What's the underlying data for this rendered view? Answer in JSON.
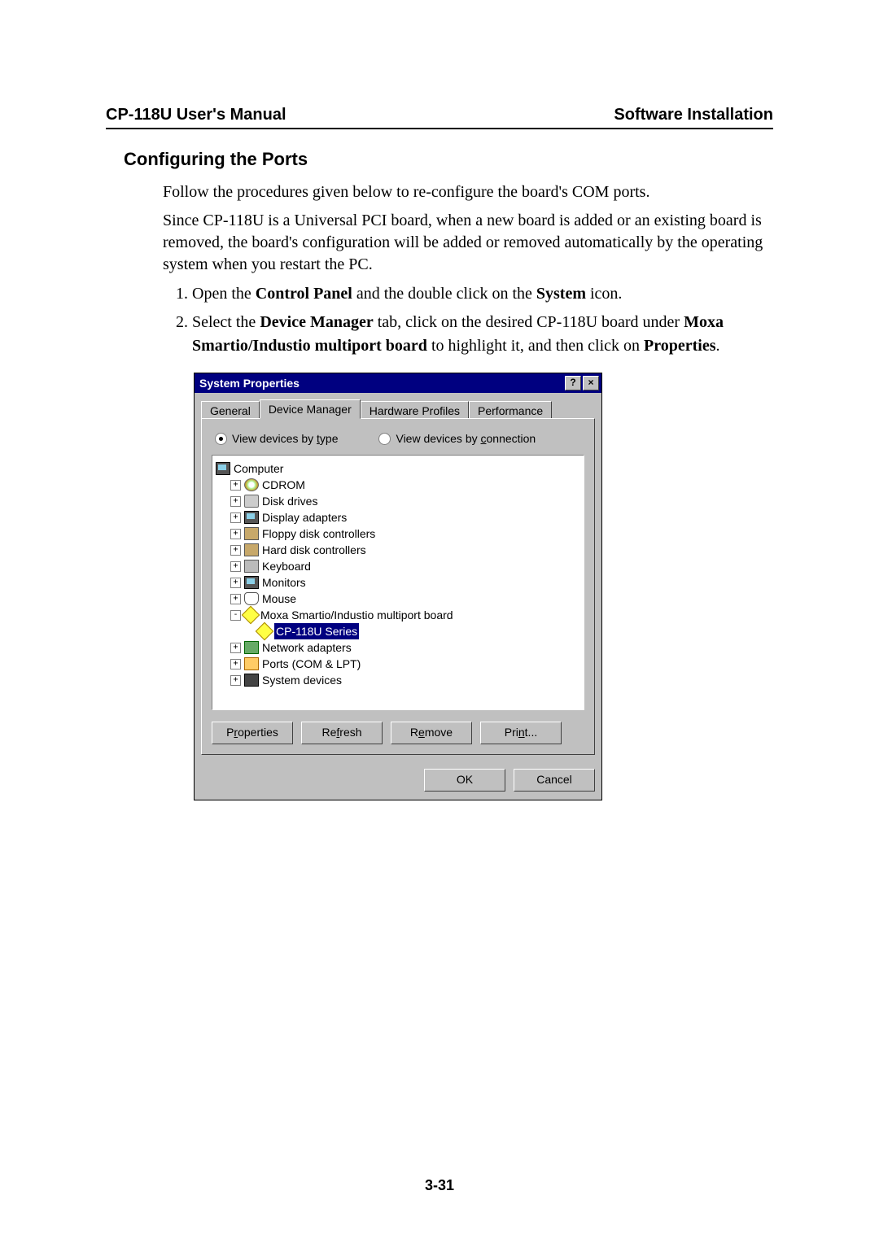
{
  "header": {
    "left": "CP-118U User's Manual",
    "right": "Software Installation"
  },
  "section_heading": "Configuring the Ports",
  "intro1": "Follow the procedures given below to re-configure the board's COM ports.",
  "intro2": "Since CP-118U is a Universal PCI board, when a new board is added or an existing board is removed, the board's configuration will be added or removed automatically by the operating system when you restart the PC.",
  "steps": {
    "s1_a": "Open the ",
    "s1_b": "Control Panel",
    "s1_c": " and the double click on the ",
    "s1_d": "System",
    "s1_e": " icon.",
    "s2_a": "Select the ",
    "s2_b": "Device Manager",
    "s2_c": " tab, click on the desired CP-118U board under ",
    "s2_d": "Moxa Smartio/Industio multiport board",
    "s2_e": " to highlight it, and then click on ",
    "s2_f": "Properties",
    "s2_g": "."
  },
  "dialog": {
    "title": "System Properties",
    "help_btn": "?",
    "close_btn": "×",
    "tabs": {
      "general": "General",
      "device_manager": "Device Manager",
      "hardware_profiles": "Hardware Profiles",
      "performance": "Performance"
    },
    "radios": {
      "by_type_pre": "View devices by ",
      "by_type_u": "t",
      "by_type_post": "ype",
      "by_conn_pre": "View devices by ",
      "by_conn_u": "c",
      "by_conn_post": "onnection"
    },
    "tree": {
      "computer": "Computer",
      "cdrom": "CDROM",
      "disk_drives": "Disk drives",
      "display_adapters": "Display adapters",
      "floppy": "Floppy disk controllers",
      "hdd": "Hard disk controllers",
      "keyboard": "Keyboard",
      "monitors": "Monitors",
      "mouse": "Mouse",
      "moxa": "Moxa Smartio/Industio multiport board",
      "cp118u": "CP-118U Series",
      "network": "Network adapters",
      "ports": "Ports (COM & LPT)",
      "system_devices": "System devices"
    },
    "buttons": {
      "properties_pre": "P",
      "properties_u": "r",
      "properties_post": "operties",
      "refresh_pre": "Re",
      "refresh_u": "f",
      "refresh_post": "resh",
      "remove_pre": "R",
      "remove_u": "e",
      "remove_post": "move",
      "print_pre": "Pri",
      "print_u": "n",
      "print_post": "t...",
      "ok": "OK",
      "cancel": "Cancel"
    }
  },
  "page_number": "3-31"
}
